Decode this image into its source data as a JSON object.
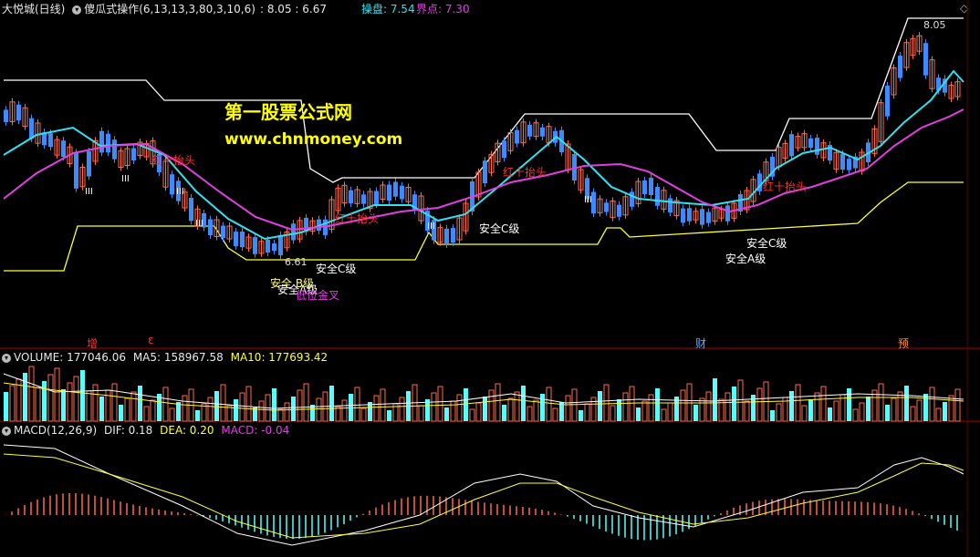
{
  "header": {
    "stock_name": "大悦城(日线)",
    "indicator_name": "傻瓜式操作(6,13,13,3,80,3,10,6)",
    "hi_lo": ": 8.05 : 6.67",
    "caopan_label": "操盘: 7.54",
    "jiedian_label": "界点: 7.30",
    "corner_icon": "diamond-icon"
  },
  "main_panel": {
    "watermark_title": "第一股票公式网",
    "watermark_url": "www.chnmoney.com",
    "high_marker": "8.05",
    "low_marker": "6.61",
    "annotations": {
      "hongshi_1": "红十抬头",
      "hongshi_2": "红十抬头",
      "hongshi_3": "红十抬头",
      "hongshi_4": "红十抬头",
      "anquan_c_1": "安全C级",
      "anquan_c_2": "安全C级",
      "anquan_c_3": "安全C级",
      "anquan_b": "安全 B级",
      "anquan_a_1": "安全A级",
      "anquan_a_2": "安全A级",
      "diwei": "低位金叉",
      "iii_1": "III",
      "iii_2": "III",
      "iii_3": "III",
      "iii_4": "III",
      "iii_5": "III",
      "iii_6": "III"
    },
    "event_markers": {
      "zeng": "增",
      "marker2": "ε",
      "cai": "财",
      "yu": "预"
    },
    "colors": {
      "up": "#ff6a4a",
      "down": "#3b8cff",
      "upper_band": "#ffffff",
      "lower_band": "#ffff33",
      "fast_ma": "#33e0f0",
      "slow_ma": "#e040e0",
      "panel_divider": "#c00000"
    }
  },
  "volume_panel": {
    "label": "VOLUME: 177046.06",
    "ma5": "MA5: 158967.58",
    "ma10": "MA10: 177693.42"
  },
  "macd_panel": {
    "label": "MACD(12,26,9)",
    "dif": "DIF: 0.18",
    "dea": "DEA: 0.20",
    "macd": "MACD: -0.04"
  }
}
